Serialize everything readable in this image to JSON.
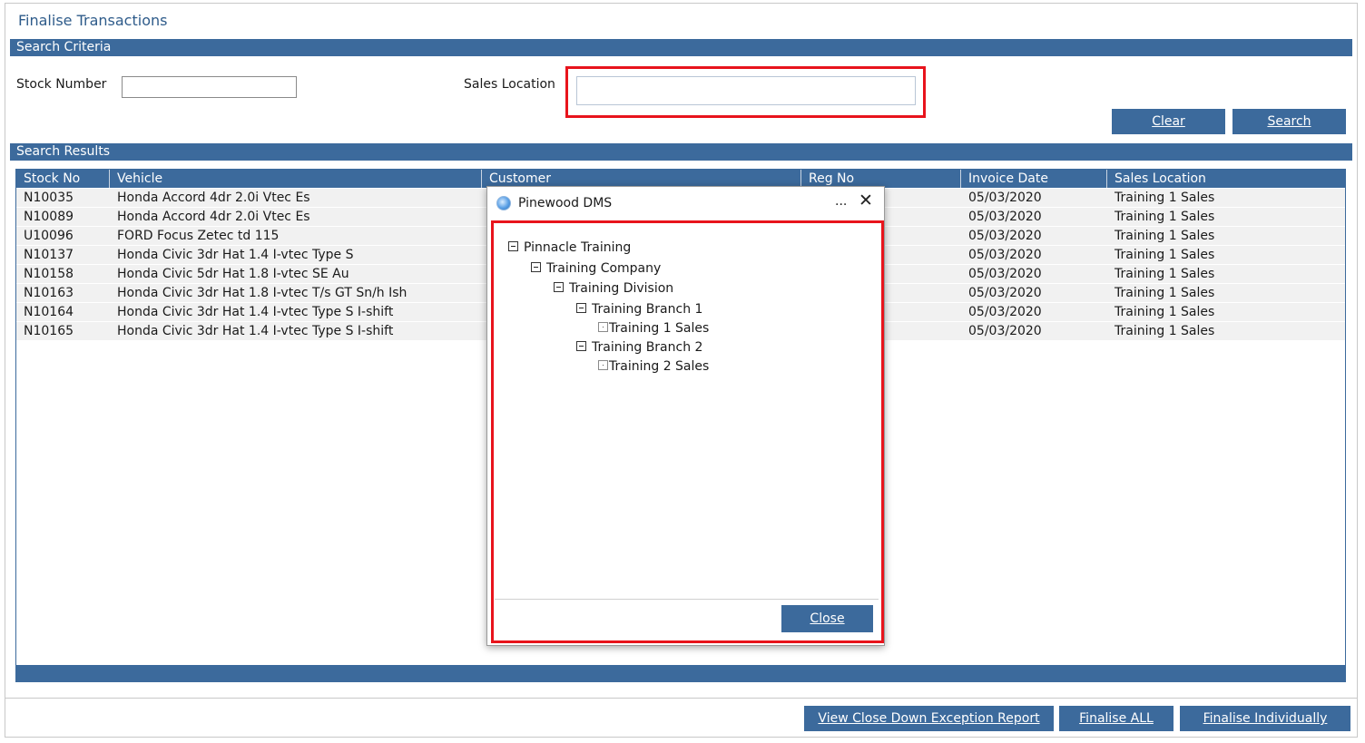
{
  "page": {
    "title": "Finalise Transactions"
  },
  "search_criteria": {
    "header": "Search Criteria",
    "stock_number_label": "Stock Number",
    "stock_number_value": "",
    "sales_location_label": "Sales Location",
    "sales_location_value": "",
    "clear_label": "Clear",
    "search_label": "Search"
  },
  "search_results": {
    "header": "Search Results",
    "columns": [
      "Stock No",
      "Vehicle",
      "Customer",
      "Reg No",
      "Invoice Date",
      "Sales Location"
    ],
    "rows": [
      [
        "N10035",
        "Honda Accord 4dr 2.0i Vtec Es",
        "",
        "",
        "05/03/2020",
        "Training 1 Sales"
      ],
      [
        "N10089",
        "Honda Accord 4dr 2.0i Vtec Es",
        "",
        "",
        "05/03/2020",
        "Training 1 Sales"
      ],
      [
        "U10096",
        "FORD Focus Zetec td 115",
        "",
        "",
        "05/03/2020",
        "Training 1 Sales"
      ],
      [
        "N10137",
        "Honda Civic 3dr Hat 1.4 I-vtec Type S",
        "",
        "",
        "05/03/2020",
        "Training 1 Sales"
      ],
      [
        "N10158",
        "Honda Civic 5dr Hat 1.8 I-vtec SE Au",
        "",
        "",
        "05/03/2020",
        "Training 1 Sales"
      ],
      [
        "N10163",
        "Honda Civic 3dr Hat 1.8 I-vtec T/s GT Sn/h Ish",
        "",
        "",
        "05/03/2020",
        "Training 1 Sales"
      ],
      [
        "N10164",
        "Honda Civic 3dr Hat 1.4 I-vtec Type S I-shift",
        "",
        "",
        "05/03/2020",
        "Training 1 Sales"
      ],
      [
        "N10165",
        "Honda Civic 3dr Hat 1.4 I-vtec Type S I-shift",
        "",
        "",
        "05/03/2020",
        "Training 1 Sales"
      ]
    ]
  },
  "footer": {
    "exception_report_label": "View Close Down Exception Report",
    "finalise_all_label": "Finalise ALL",
    "finalise_individually_label": "Finalise Individually"
  },
  "dialog": {
    "title": "Pinewood DMS",
    "ellipsis": "...",
    "close_glyph": "✕",
    "close_button_label": "Close",
    "tree": [
      {
        "label": "Pinnacle Training",
        "toggle": "minus"
      },
      {
        "label": "Training Company",
        "toggle": "minus"
      },
      {
        "label": "Training Division",
        "toggle": "minus"
      },
      {
        "label": "Training Branch 1",
        "toggle": "minus"
      },
      {
        "label": "Training 1 Sales",
        "toggle": "leaf"
      },
      {
        "label": "Training Branch 2",
        "toggle": "minus"
      },
      {
        "label": "Training 2 Sales",
        "toggle": "leaf"
      }
    ]
  },
  "colors": {
    "accent": "#3c6a9c",
    "highlight": "#e8141c",
    "title": "#2e5b8a"
  }
}
